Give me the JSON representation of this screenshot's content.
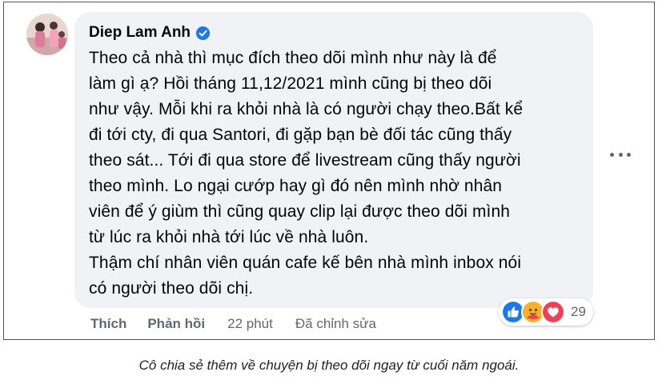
{
  "comment": {
    "author": "Diep Lam Anh",
    "text": "Theo cả nhà thì mục đích theo dõi mình như này là để\nlàm gì ạ? Hồi tháng 11,12/2021 mình cũng bị theo dõi\nnhư vậy. Mỗi khi ra khỏi nhà là có người chạy theo.Bất kể\nđi tới cty, đi qua Santori, đi gặp bạn bè đối tác cũng thấy\ntheo sát... Tới đi qua store để livestream cũng thấy người\ntheo mình. Lo ngại cướp hay gì đó nên mình nhờ nhân\nviên để ý giùm thì cũng quay clip lại được theo dõi mình\ntừ lúc ra khỏi nhà tới lúc về nhà luôn.\nThậm chí nhân viên quán cafe kế bên nhà mình inbox nói\ncó người theo dõi chị.",
    "reactions": {
      "icons": [
        "like-icon",
        "care-icon",
        "love-icon"
      ],
      "count": "29"
    },
    "actions": {
      "like": "Thích",
      "reply": "Phản hồi",
      "time": "22 phút",
      "edited": "Đã chỉnh sửa"
    }
  },
  "caption": "Cô chia sẻ thêm về chuyện bị theo dõi ngay từ cuối năm ngoái.",
  "colors": {
    "bubble": "#f0f2f5",
    "verified": "#1877f2",
    "meta_text": "#65676b",
    "like": "#1877f2",
    "love": "#f33e58",
    "care": "#f7b125"
  }
}
